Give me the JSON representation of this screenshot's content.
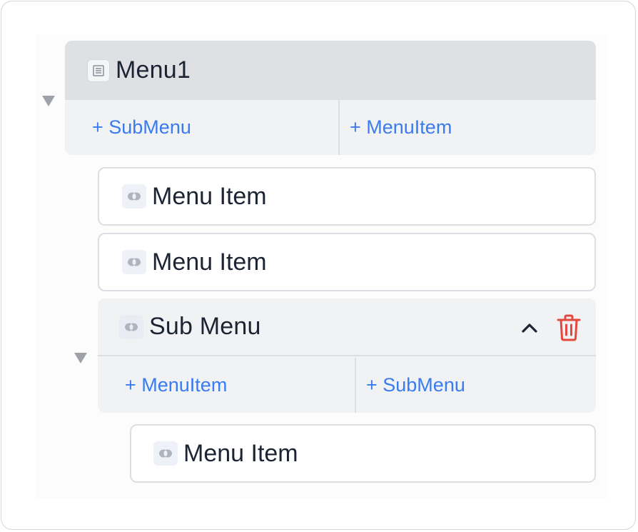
{
  "menu1": {
    "title": "Menu1",
    "add_submenu": "+ SubMenu",
    "add_menuitem": "+ MenuItem",
    "icon": "document-icon"
  },
  "items": [
    {
      "label": "Menu Item",
      "icon": "link-icon"
    },
    {
      "label": "Menu Item",
      "icon": "link-icon"
    }
  ],
  "submenu": {
    "title": "Sub Menu",
    "icon": "link-icon",
    "add_menuitem": "+ MenuItem",
    "add_submenu": "+ SubMenu",
    "collapse_icon": "chevron-up-icon",
    "delete_icon": "trash-icon",
    "items": [
      {
        "label": "Menu Item",
        "icon": "link-icon"
      }
    ]
  },
  "colors": {
    "accent": "#3a7bf0",
    "danger": "#e5483f",
    "header_bg": "#dfe0e4",
    "block_bg": "#f1f2f4",
    "text": "#1c2434"
  }
}
